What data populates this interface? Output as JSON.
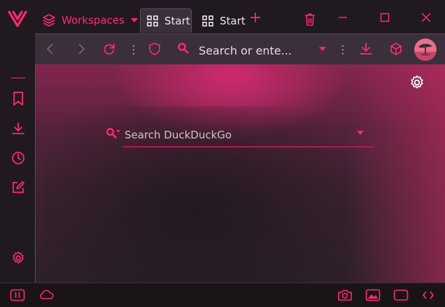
{
  "titlebar": {
    "workspaces_label": "Workspaces",
    "tabs": [
      {
        "label": "Start",
        "active": true
      },
      {
        "label": "Start",
        "active": false
      }
    ]
  },
  "addressbar": {
    "placeholder": "Search or ente..."
  },
  "search": {
    "placeholder": "Search DuckDuckGo"
  },
  "colors": {
    "accent": "#ff2a6d",
    "background": "#211920",
    "toolbar": "#3a2f3b"
  },
  "icons": {
    "sidebar": [
      "vivaldi-logo-icon",
      "bookmarks-icon",
      "downloads-icon",
      "history-icon",
      "notes-icon",
      "settings-icon"
    ],
    "statusbar": [
      "panel-toggle-icon",
      "cloud-sync-icon",
      "capture-icon",
      "image-icon",
      "window-icon",
      "code-icon"
    ]
  }
}
